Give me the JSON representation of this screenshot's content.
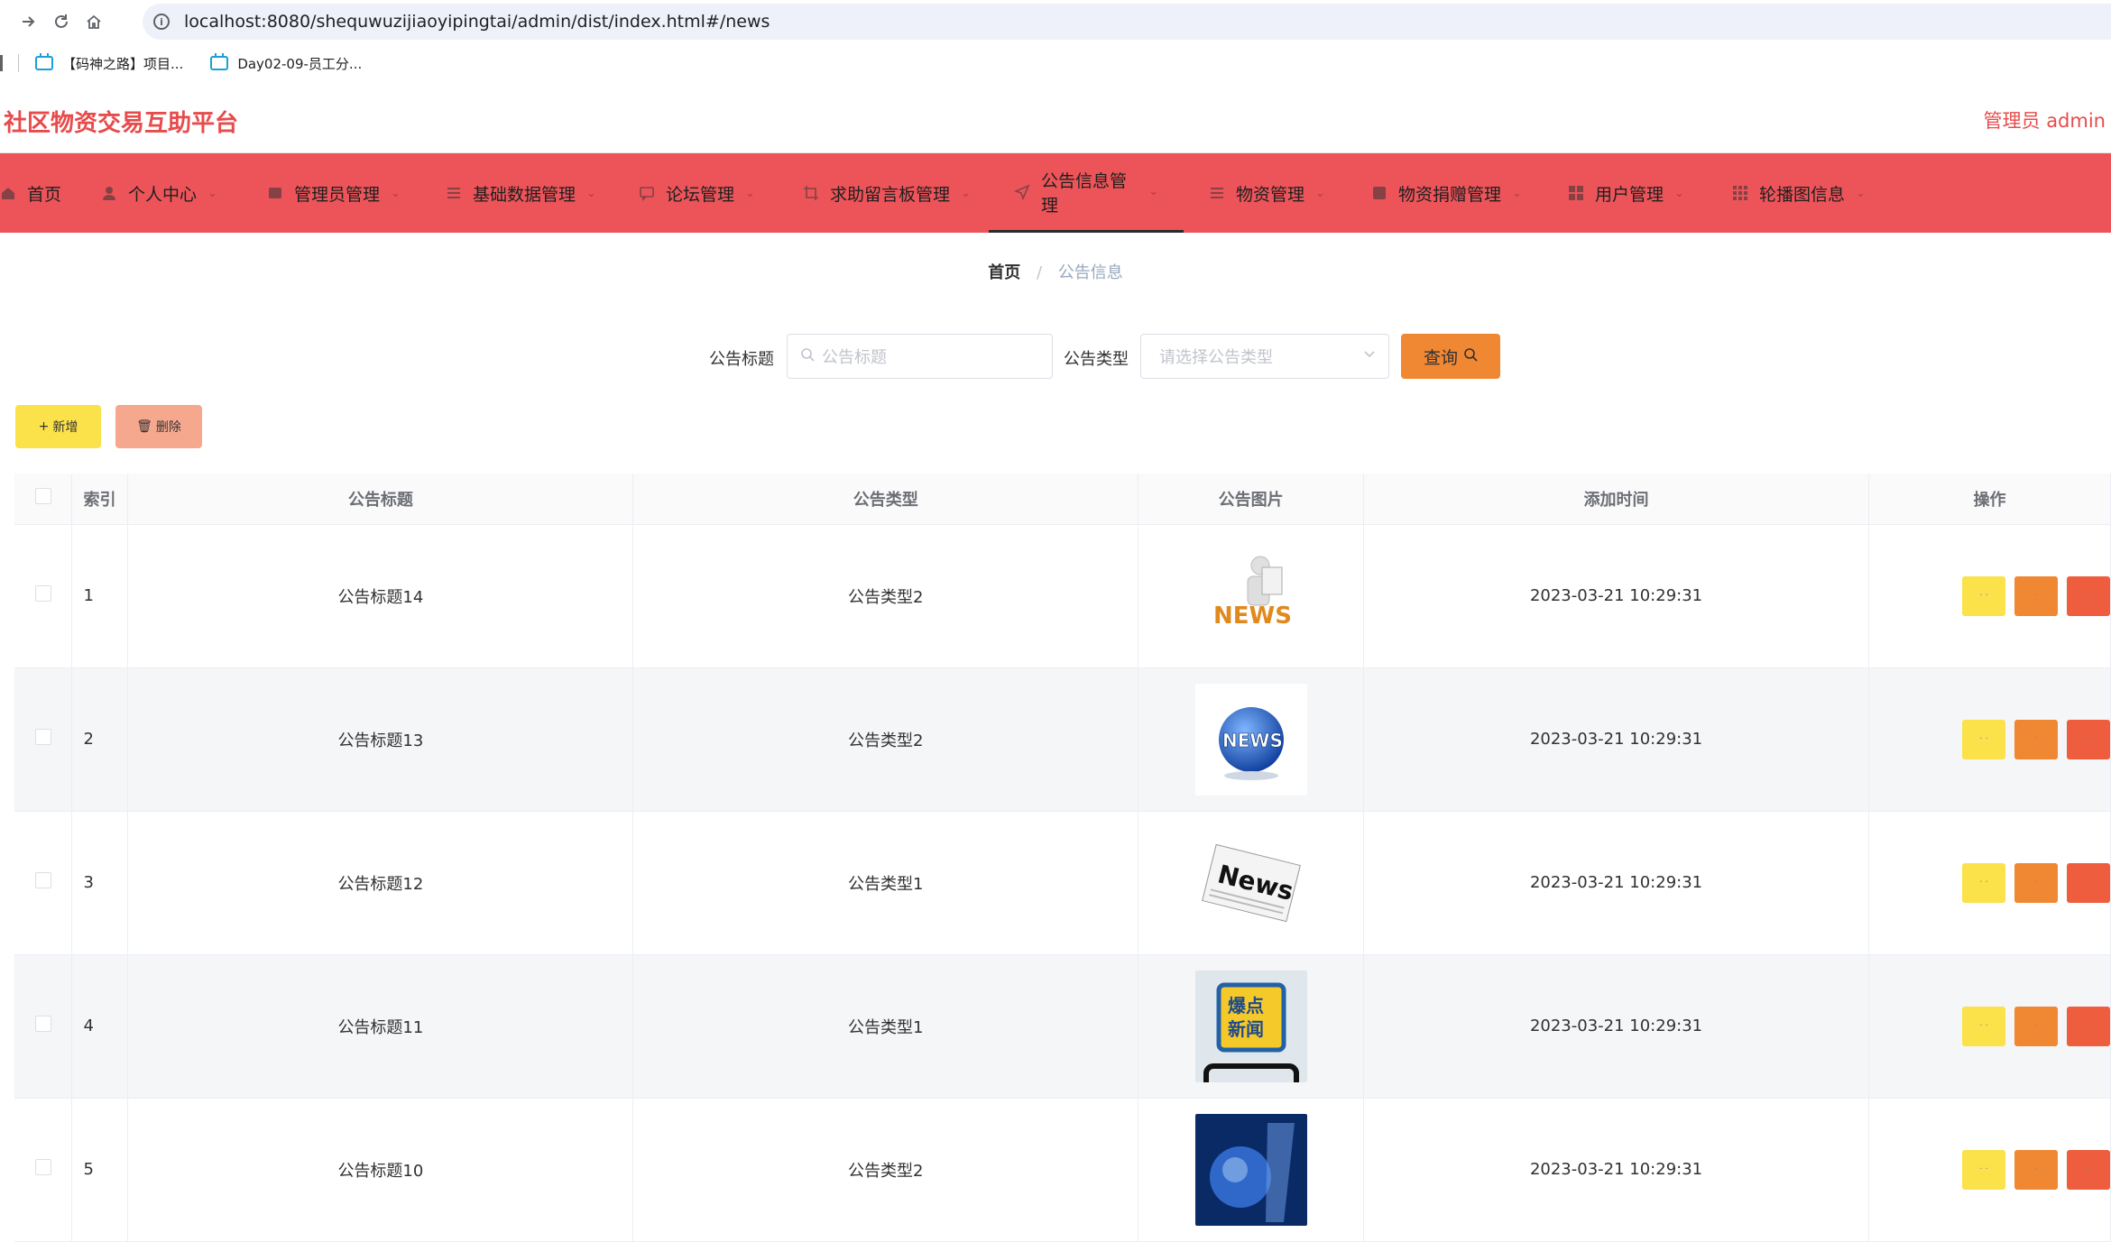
{
  "browser": {
    "url": "localhost:8080/shequwuzijiaoyipingtai/admin/dist/index.html#/news",
    "bookmarks": [
      "【码神之路】项目...",
      "Day02-09-员工分..."
    ]
  },
  "header": {
    "title": "社区物资交易互助平台",
    "user": "管理员 admin"
  },
  "nav": {
    "items": [
      {
        "label": "首页",
        "icon": "home-icon"
      },
      {
        "label": "个人中心",
        "icon": "user-icon"
      },
      {
        "label": "管理员管理",
        "icon": "admin-icon"
      },
      {
        "label": "基础数据管理",
        "icon": "sliders-icon"
      },
      {
        "label": "论坛管理",
        "icon": "chat-icon"
      },
      {
        "label": "求助留言板管理",
        "icon": "crop-icon"
      },
      {
        "label": "公告信息管理",
        "icon": "send-icon"
      },
      {
        "label": "物资管理",
        "icon": "list-icon"
      },
      {
        "label": "物资捐赠管理",
        "icon": "doc-icon"
      },
      {
        "label": "用户管理",
        "icon": "grid-icon"
      },
      {
        "label": "轮播图信息",
        "icon": "apps-icon"
      }
    ],
    "active": "公告信息管理"
  },
  "breadcrumb": {
    "home": "首页",
    "sep": "/",
    "current": "公告信息"
  },
  "search": {
    "title_label": "公告标题",
    "title_placeholder": "公告标题",
    "type_label": "公告类型",
    "type_placeholder": "请选择公告类型",
    "query_button": "查询"
  },
  "actions": {
    "add": "新增",
    "delete": "删除"
  },
  "table": {
    "columns": [
      "索引",
      "公告标题",
      "公告类型",
      "公告图片",
      "添加时间",
      "操作"
    ],
    "rows": [
      {
        "index": "1",
        "title": "公告标题14",
        "type": "公告类型2",
        "image": "news-3d-man",
        "time": "2023-03-21 10:29:31"
      },
      {
        "index": "2",
        "title": "公告标题13",
        "type": "公告类型2",
        "image": "news-globe",
        "time": "2023-03-21 10:29:31"
      },
      {
        "index": "3",
        "title": "公告标题12",
        "type": "公告类型1",
        "image": "news-paper",
        "time": "2023-03-21 10:29:31"
      },
      {
        "index": "4",
        "title": "公告标题11",
        "type": "公告类型1",
        "image": "breaking-news-badge",
        "time": "2023-03-21 10:29:31"
      },
      {
        "index": "5",
        "title": "公告标题10",
        "type": "公告类型2",
        "image": "news-blue-globe",
        "time": "2023-03-21 10:29:31"
      }
    ]
  },
  "colors": {
    "brand": "#ec5459",
    "title_red": "#e84b4b",
    "query_orange": "#f08732",
    "add_yellow": "#fbe14a",
    "delete_salmon": "#f6a88e",
    "op_yellow": "#fbe14a",
    "op_orange": "#f08732",
    "op_red": "#ee5d3e"
  }
}
